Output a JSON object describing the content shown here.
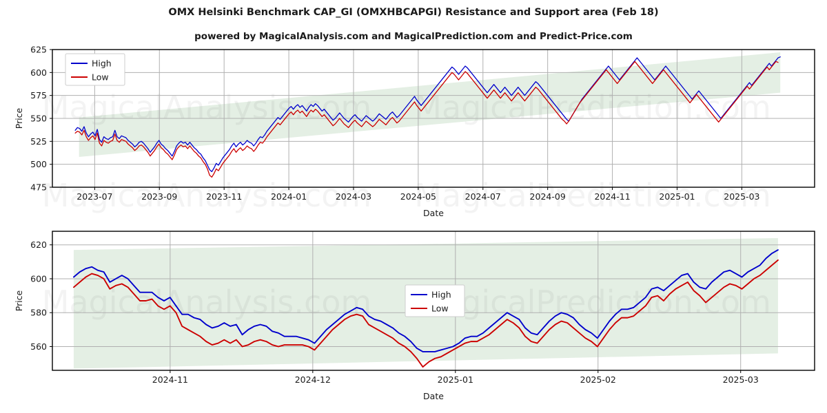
{
  "header": {
    "title": "OMX Helsinki Benchmark CAP_GI (OMXHBCAPGI) Resistance and Support area (Feb 18)",
    "subtitle": "powered by MagicalAnalysis.com and MagicalPrediction.com and Predict-Price.com"
  },
  "watermarks": {
    "left": "MagicalAnalysis.com",
    "right": "MagicalPrediction.com"
  },
  "colors": {
    "high": "#0000cc",
    "low": "#cc0000",
    "band": "#e4efe4",
    "grid": "#b0b0b0",
    "axis": "#000000"
  },
  "legend": {
    "high_label": "High",
    "low_label": "Low"
  },
  "chart_data": [
    {
      "id": "upper",
      "type": "line",
      "title": "OMX Helsinki Benchmark CAP_GI (OMXHBCAPGI) Resistance and Support area (Feb 18)",
      "xlabel": "Date",
      "ylabel": "Price",
      "grid": true,
      "legend_position": "upper-left",
      "ylim": [
        475,
        625
      ],
      "yticks": [
        475,
        500,
        525,
        550,
        575,
        600,
        625
      ],
      "xticks": [
        "2023-07",
        "2023-09",
        "2023-11",
        "2024-01",
        "2024-03",
        "2024-05",
        "2024-07",
        "2024-09",
        "2024-11",
        "2025-01",
        "2025-03"
      ],
      "xlim": [
        "2023-06-10",
        "2025-03-20"
      ],
      "band": {
        "name": "Resistance and Support area",
        "color": "#e4efe4",
        "x_start": "2023-06-16",
        "x_end": "2025-03-05",
        "upper_start": 551,
        "upper_end": 622,
        "lower_start": 508,
        "lower_end": 578
      },
      "series": [
        {
          "name": "High",
          "color": "#0000cc",
          "values": [
            537,
            540,
            539,
            536,
            541,
            534,
            530,
            533,
            535,
            531,
            538,
            527,
            524,
            530,
            528,
            527,
            529,
            530,
            537,
            530,
            528,
            531,
            530,
            529,
            526,
            524,
            522,
            519,
            521,
            524,
            525,
            523,
            520,
            517,
            513,
            516,
            519,
            523,
            526,
            522,
            520,
            517,
            515,
            512,
            509,
            514,
            520,
            523,
            525,
            523,
            524,
            521,
            524,
            521,
            518,
            516,
            513,
            511,
            507,
            504,
            499,
            494,
            492,
            496,
            501,
            499,
            503,
            507,
            510,
            513,
            516,
            520,
            523,
            519,
            522,
            524,
            521,
            523,
            526,
            524,
            523,
            520,
            523,
            527,
            530,
            529,
            532,
            536,
            539,
            542,
            545,
            548,
            551,
            549,
            552,
            555,
            558,
            561,
            563,
            560,
            563,
            565,
            562,
            564,
            561,
            558,
            562,
            565,
            563,
            566,
            564,
            561,
            558,
            560,
            557,
            554,
            551,
            548,
            550,
            553,
            556,
            553,
            550,
            548,
            546,
            549,
            552,
            554,
            551,
            549,
            547,
            550,
            553,
            551,
            549,
            547,
            549,
            552,
            555,
            553,
            551,
            549,
            552,
            555,
            557,
            554,
            551,
            553,
            556,
            559,
            562,
            565,
            568,
            571,
            574,
            570,
            567,
            564,
            567,
            570,
            573,
            576,
            579,
            582,
            585,
            588,
            591,
            594,
            597,
            600,
            603,
            606,
            604,
            601,
            598,
            601,
            604,
            607,
            605,
            602,
            599,
            596,
            593,
            590,
            587,
            584,
            581,
            578,
            581,
            584,
            587,
            584,
            581,
            578,
            581,
            584,
            581,
            578,
            575,
            578,
            581,
            584,
            581,
            578,
            575,
            578,
            581,
            584,
            587,
            590,
            588,
            585,
            582,
            579,
            576,
            573,
            570,
            567,
            564,
            561,
            558,
            555,
            552,
            549,
            547,
            551,
            555,
            559,
            563,
            567,
            571,
            574,
            577,
            580,
            583,
            586,
            589,
            592,
            595,
            598,
            601,
            604,
            607,
            604,
            601,
            598,
            595,
            592,
            595,
            598,
            601,
            604,
            607,
            610,
            613,
            616,
            613,
            610,
            607,
            604,
            601,
            598,
            595,
            592,
            595,
            598,
            601,
            604,
            607,
            604,
            601,
            598,
            595,
            592,
            589,
            586,
            583,
            580,
            577,
            574,
            571,
            574,
            577,
            580,
            577,
            574,
            571,
            568,
            565,
            562,
            559,
            556,
            553,
            550,
            553,
            556,
            559,
            562,
            565,
            568,
            571,
            574,
            577,
            580,
            583,
            586,
            589,
            586,
            589,
            592,
            595,
            598,
            601,
            604,
            607,
            610,
            607,
            610,
            613,
            616,
            617
          ]
        },
        {
          "name": "Low",
          "color": "#cc0000",
          "values": [
            534,
            536,
            535,
            532,
            537,
            530,
            526,
            529,
            531,
            527,
            534,
            523,
            520,
            526,
            524,
            523,
            525,
            526,
            533,
            526,
            524,
            527,
            526,
            525,
            522,
            520,
            518,
            515,
            517,
            520,
            521,
            519,
            516,
            513,
            509,
            512,
            515,
            519,
            522,
            518,
            516,
            513,
            511,
            508,
            505,
            510,
            516,
            519,
            521,
            519,
            520,
            517,
            520,
            517,
            514,
            512,
            509,
            507,
            503,
            500,
            495,
            488,
            486,
            490,
            495,
            493,
            497,
            501,
            504,
            507,
            510,
            514,
            517,
            513,
            516,
            518,
            515,
            517,
            520,
            518,
            517,
            514,
            517,
            521,
            524,
            523,
            526,
            530,
            533,
            536,
            539,
            542,
            545,
            543,
            546,
            549,
            552,
            555,
            557,
            554,
            557,
            559,
            556,
            558,
            555,
            552,
            556,
            559,
            557,
            560,
            558,
            555,
            552,
            554,
            551,
            548,
            545,
            542,
            544,
            547,
            550,
            547,
            544,
            542,
            540,
            543,
            546,
            548,
            545,
            543,
            541,
            544,
            547,
            545,
            543,
            541,
            543,
            546,
            549,
            547,
            545,
            543,
            546,
            549,
            551,
            548,
            545,
            547,
            550,
            553,
            556,
            559,
            562,
            565,
            568,
            564,
            561,
            558,
            561,
            564,
            567,
            570,
            573,
            576,
            579,
            582,
            585,
            588,
            591,
            594,
            597,
            600,
            598,
            595,
            592,
            595,
            598,
            601,
            599,
            596,
            593,
            590,
            587,
            584,
            581,
            578,
            575,
            572,
            575,
            578,
            581,
            578,
            575,
            572,
            575,
            578,
            575,
            572,
            569,
            572,
            575,
            578,
            575,
            572,
            569,
            572,
            575,
            578,
            581,
            584,
            582,
            579,
            576,
            573,
            570,
            567,
            564,
            561,
            558,
            555,
            552,
            549,
            547,
            544,
            547,
            551,
            555,
            559,
            563,
            567,
            570,
            573,
            576,
            579,
            582,
            585,
            588,
            591,
            594,
            597,
            600,
            603,
            600,
            597,
            594,
            591,
            588,
            591,
            594,
            597,
            600,
            603,
            606,
            609,
            612,
            609,
            606,
            603,
            600,
            597,
            594,
            591,
            588,
            591,
            594,
            597,
            600,
            603,
            600,
            597,
            594,
            591,
            588,
            585,
            582,
            579,
            576,
            573,
            570,
            567,
            570,
            573,
            576,
            573,
            570,
            567,
            564,
            561,
            558,
            555,
            552,
            549,
            546,
            549,
            552,
            555,
            558,
            561,
            564,
            567,
            570,
            573,
            576,
            579,
            582,
            585,
            582,
            585,
            588,
            591,
            594,
            597,
            600,
            603,
            606,
            603,
            606,
            609,
            612,
            611
          ]
        }
      ]
    },
    {
      "id": "lower",
      "type": "line",
      "xlabel": "Date",
      "ylabel": "Price",
      "grid": true,
      "legend_position": "center-right",
      "ylim": [
        546,
        628
      ],
      "yticks": [
        560,
        580,
        600,
        620
      ],
      "xticks": [
        "2024-11",
        "2024-12",
        "2025-01",
        "2025-02",
        "2025-03"
      ],
      "xlim": [
        "2024-10-12",
        "2025-03-12"
      ],
      "band": {
        "name": "Resistance and Support area",
        "color": "#e4efe4",
        "x_start": "2024-10-17",
        "x_end": "2025-03-05",
        "upper_start": 617,
        "upper_end": 624,
        "lower_start": 547,
        "lower_end": 556
      },
      "series": [
        {
          "name": "High",
          "color": "#0000cc",
          "values": [
            601,
            604,
            606,
            607,
            605,
            604,
            598,
            600,
            602,
            600,
            596,
            592,
            592,
            592,
            589,
            587,
            589,
            584,
            579,
            579,
            577,
            576,
            573,
            571,
            572,
            574,
            572,
            573,
            567,
            570,
            572,
            573,
            572,
            569,
            568,
            566,
            566,
            566,
            565,
            564,
            562,
            566,
            570,
            573,
            576,
            579,
            581,
            583,
            582,
            578,
            576,
            575,
            573,
            571,
            568,
            566,
            563,
            559,
            557,
            557,
            557,
            558,
            559,
            560,
            562,
            565,
            566,
            566,
            568,
            571,
            574,
            577,
            580,
            578,
            576,
            571,
            568,
            567,
            571,
            575,
            578,
            580,
            579,
            577,
            573,
            570,
            568,
            565,
            570,
            575,
            579,
            582,
            582,
            583,
            586,
            589,
            594,
            595,
            593,
            596,
            599,
            602,
            603,
            598,
            595,
            594,
            598,
            601,
            604,
            605,
            603,
            601,
            604,
            606,
            608,
            612,
            615,
            617
          ]
        },
        {
          "name": "Low",
          "color": "#cc0000",
          "values": [
            595,
            598,
            601,
            603,
            602,
            600,
            594,
            596,
            597,
            595,
            591,
            587,
            587,
            588,
            584,
            582,
            584,
            580,
            572,
            570,
            568,
            566,
            563,
            561,
            562,
            564,
            562,
            564,
            560,
            561,
            563,
            564,
            563,
            561,
            560,
            561,
            561,
            561,
            561,
            560,
            558,
            562,
            566,
            570,
            573,
            576,
            578,
            579,
            578,
            573,
            571,
            569,
            567,
            565,
            562,
            560,
            557,
            553,
            548,
            551,
            553,
            554,
            556,
            558,
            560,
            562,
            563,
            563,
            565,
            567,
            570,
            573,
            576,
            574,
            571,
            566,
            563,
            562,
            566,
            570,
            573,
            575,
            574,
            571,
            568,
            565,
            563,
            560,
            565,
            570,
            574,
            577,
            577,
            578,
            581,
            584,
            589,
            590,
            587,
            591,
            594,
            596,
            598,
            593,
            590,
            586,
            589,
            592,
            595,
            597,
            596,
            594,
            597,
            600,
            602,
            605,
            608,
            611
          ]
        }
      ]
    }
  ]
}
